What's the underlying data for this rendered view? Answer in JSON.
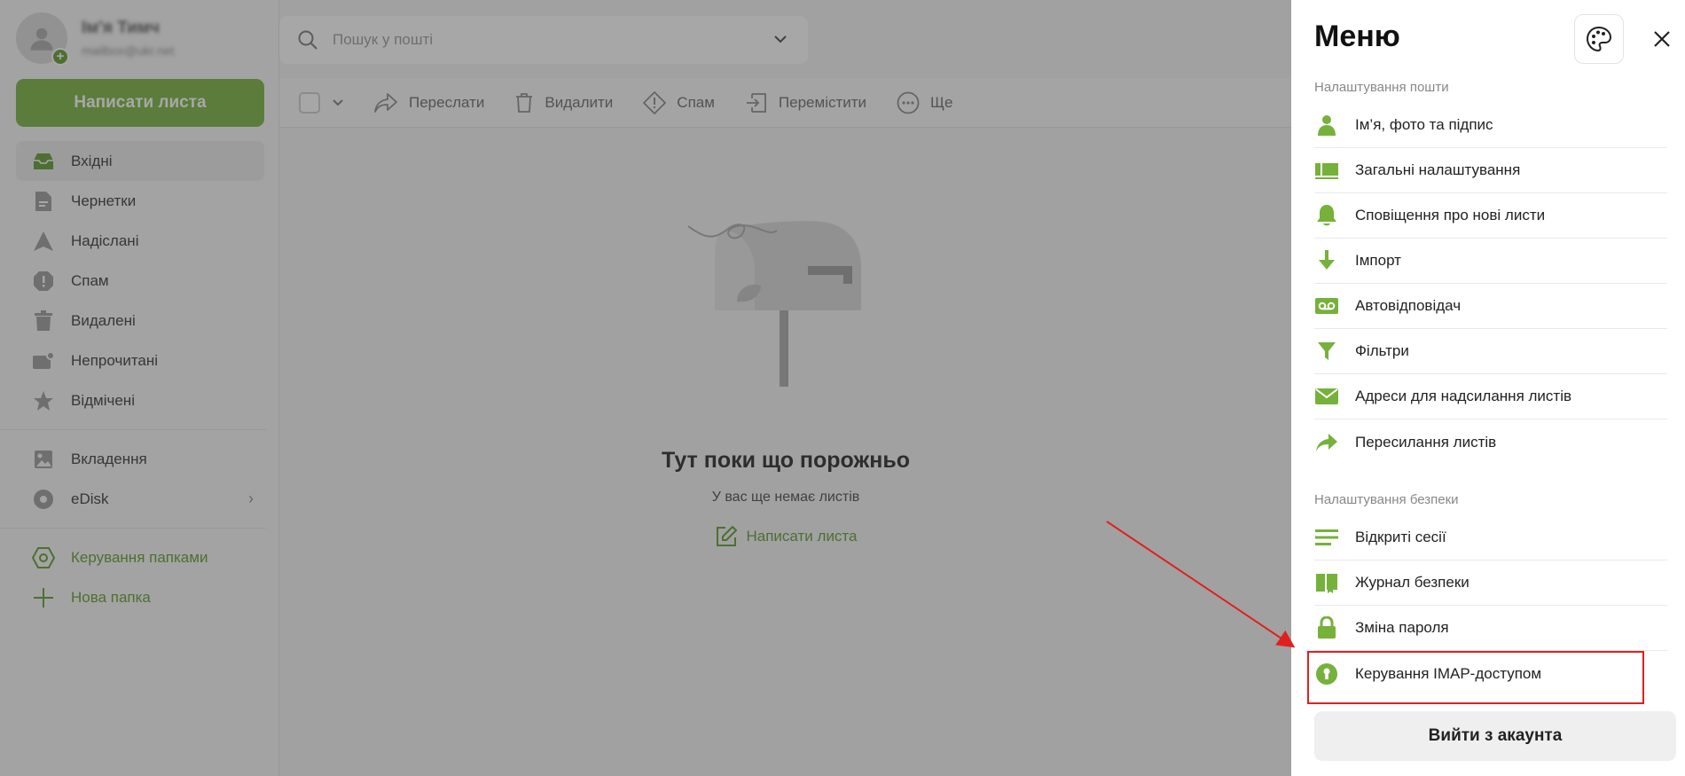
{
  "profile": {
    "name": "Ім'я Тимч",
    "email": "mailbox@ukr.net"
  },
  "compose_label": "Написати листа",
  "folders": [
    {
      "label": "Вхідні",
      "icon": "inbox-icon"
    },
    {
      "label": "Чернетки",
      "icon": "draft-icon"
    },
    {
      "label": "Надіслані",
      "icon": "sent-icon"
    },
    {
      "label": "Спам",
      "icon": "spam-icon"
    },
    {
      "label": "Видалені",
      "icon": "trash-icon"
    },
    {
      "label": "Непрочитані",
      "icon": "unread-icon"
    },
    {
      "label": "Відмічені",
      "icon": "star-icon"
    }
  ],
  "extra_folders": [
    {
      "label": "Вкладення",
      "icon": "image-icon"
    },
    {
      "label": "eDisk",
      "icon": "disk-icon"
    }
  ],
  "folder_actions": [
    {
      "label": "Керування папками",
      "icon": "folder-settings-icon"
    },
    {
      "label": "Нова папка",
      "icon": "plus-icon"
    }
  ],
  "search": {
    "placeholder": "Пошук у пошті"
  },
  "toolbar": {
    "forward": "Переслати",
    "delete": "Видалити",
    "spam": "Спам",
    "move": "Перемістити",
    "more": "Ще"
  },
  "empty": {
    "title": "Тут поки що порожньо",
    "subtitle": "У вас ще немає листів",
    "link": "Написати листа"
  },
  "menu": {
    "title": "Меню",
    "mail_settings_title": "Налаштування пошти",
    "mail_settings": [
      {
        "label": "Ім’я, фото та підпис",
        "icon": "person-icon"
      },
      {
        "label": "Загальні налаштування",
        "icon": "settings-panel-icon"
      },
      {
        "label": "Сповіщення про нові листи",
        "icon": "bell-icon"
      },
      {
        "label": "Імпорт",
        "icon": "download-arrow-icon"
      },
      {
        "label": "Автовідповідач",
        "icon": "voicemail-icon"
      },
      {
        "label": "Фільтри",
        "icon": "filter-icon"
      },
      {
        "label": "Адреси для надсилання листів",
        "icon": "envelope-icon"
      },
      {
        "label": "Пересилання листів",
        "icon": "forward-arrow-icon"
      }
    ],
    "security_title": "Налаштування безпеки",
    "security": [
      {
        "label": "Відкриті сесії",
        "icon": "sessions-icon"
      },
      {
        "label": "Журнал безпеки",
        "icon": "book-icon"
      },
      {
        "label": "Зміна пароля",
        "icon": "lock-icon"
      },
      {
        "label": "Керування IMAP-доступом",
        "icon": "keyhole-icon"
      }
    ],
    "logout": "Вийти з акаунта"
  },
  "colors": {
    "accent": "#76b13b",
    "accent_dark": "#5d9a2c",
    "annotation": "#e02020"
  }
}
